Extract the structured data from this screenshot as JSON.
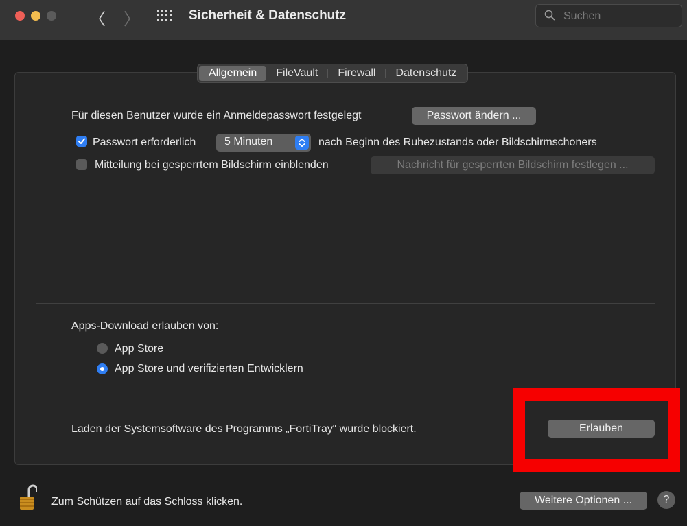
{
  "window": {
    "title": "Sicherheit & Datenschutz",
    "back_glyph": "〈",
    "forward_glyph": "〉",
    "search_placeholder": "Suchen"
  },
  "tabs": [
    {
      "label": "Allgemein",
      "active": true
    },
    {
      "label": "FileVault",
      "active": false
    },
    {
      "label": "Firewall",
      "active": false
    },
    {
      "label": "Datenschutz",
      "active": false
    }
  ],
  "general": {
    "password_set_text": "Für diesen Benutzer wurde ein Anmeldepasswort festgelegt",
    "change_password_button": "Passwort ändern ...",
    "require_password": {
      "label": "Passwort erforderlich",
      "checked": true,
      "interval": "5 Minuten",
      "suffix": "nach Beginn des Ruhezustands oder Bildschirmschoners"
    },
    "lock_message": {
      "label": "Mitteilung bei gesperrtem Bildschirm einblenden",
      "checked": false,
      "button": "Nachricht für gesperrten Bildschirm festlegen ..."
    }
  },
  "downloads": {
    "heading": "Apps-Download erlauben von:",
    "options": [
      {
        "label": "App Store",
        "selected": false
      },
      {
        "label": "App Store und verifizierten Entwicklern",
        "selected": true
      }
    ]
  },
  "blocked": {
    "text": "Laden der Systemsoftware des Programms „FortiTray“ wurde blockiert.",
    "allow_button": "Erlauben"
  },
  "footer": {
    "lock_text": "Zum Schützen auf das Schloss klicken.",
    "more_options_button": "Weitere Optionen ...",
    "help_label": "?"
  },
  "colors": {
    "accent": "#2f7ef3",
    "highlight": "#f60000",
    "background": "#1e1e1e"
  }
}
